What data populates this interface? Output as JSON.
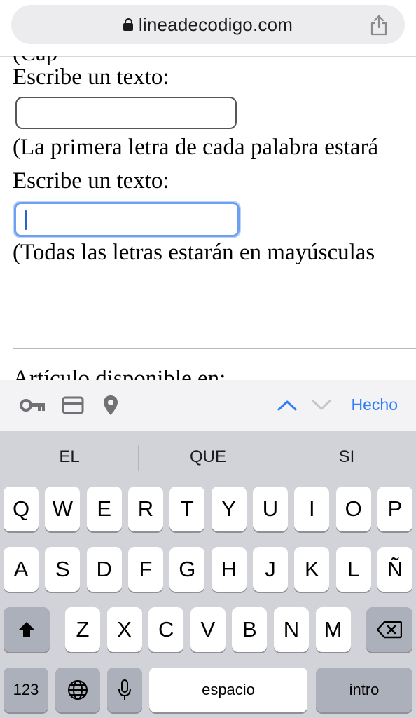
{
  "browser": {
    "url": "lineadecodigo.com",
    "icons": [
      "lock-icon",
      "share-icon"
    ]
  },
  "page": {
    "cutoff_text": "(Cap",
    "label1": "Escribe un texto:",
    "input1_value": "",
    "note1": "(La primera letra de cada palabra estará",
    "label2": "Escribe un texto:",
    "input2_value": "",
    "note2": "(Todas las letras estarán en mayúsculas",
    "footer_text": "Artículo disponible en:"
  },
  "accessory": {
    "icons": [
      "key-icon",
      "credit-card-icon",
      "location-icon"
    ],
    "done_label": "Hecho",
    "accent": "#2f7cf6"
  },
  "keyboard": {
    "suggestions": [
      "EL",
      "QUE",
      "SI"
    ],
    "row1": [
      "Q",
      "W",
      "E",
      "R",
      "T",
      "Y",
      "U",
      "I",
      "O",
      "P"
    ],
    "row2": [
      "A",
      "S",
      "D",
      "F",
      "G",
      "H",
      "J",
      "K",
      "L",
      "Ñ"
    ],
    "row3": [
      "Z",
      "X",
      "C",
      "V",
      "B",
      "N",
      "M"
    ],
    "numbers_label": "123",
    "space_label": "espacio",
    "return_label": "intro"
  }
}
